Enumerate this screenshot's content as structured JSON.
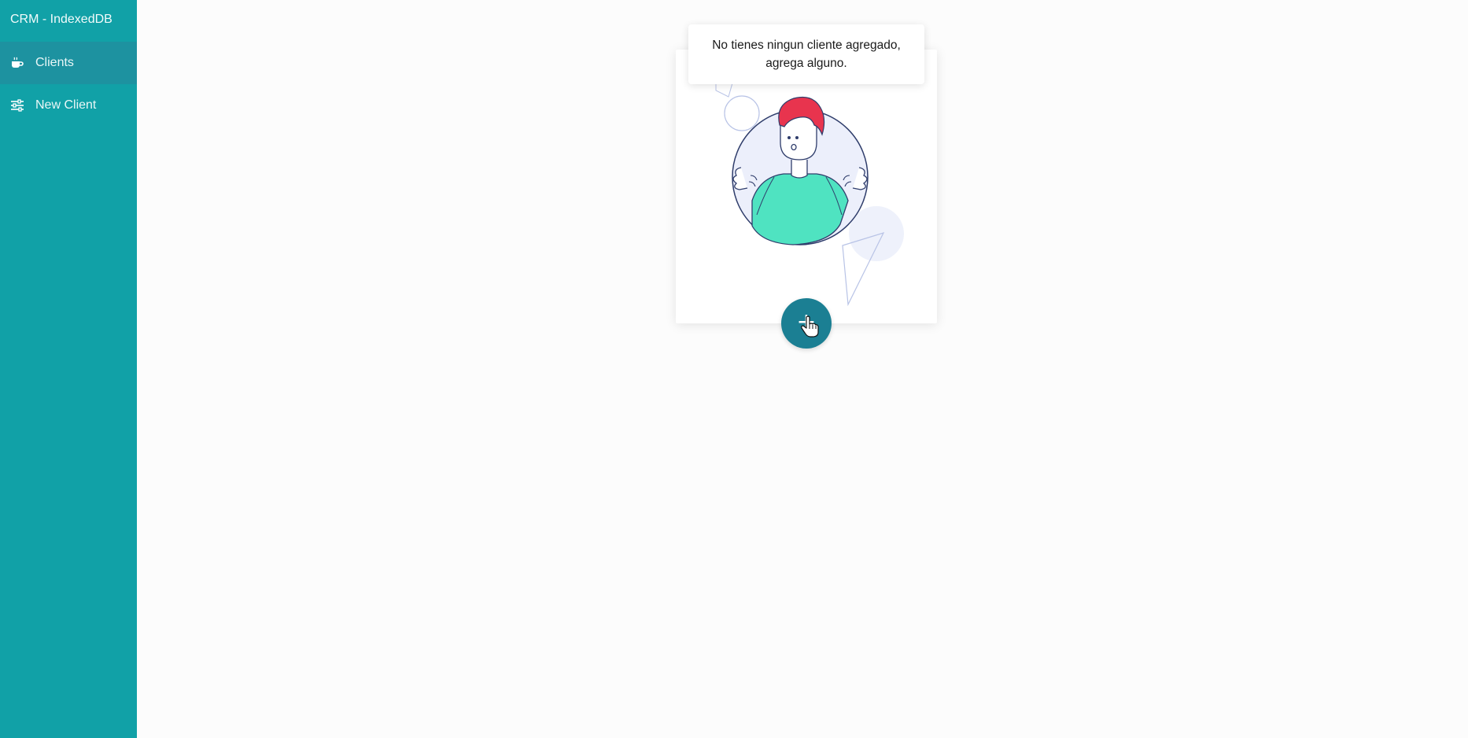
{
  "app": {
    "title": "CRM - IndexedDB"
  },
  "sidebar": {
    "items": [
      {
        "label": "Clients",
        "icon": "coffee-icon",
        "active": true
      },
      {
        "label": "New Client",
        "icon": "sliders-icon",
        "active": false
      }
    ]
  },
  "main": {
    "empty_state": {
      "message": "No tienes ningun cliente agregado, agrega alguno.",
      "add_button_label": "+"
    }
  },
  "colors": {
    "sidebar_bg": "#11a1a7",
    "active_item_bg": "#1d92a0",
    "fab_bg": "#1b7f93",
    "page_bg": "#fcfcfc",
    "shirt": "#4fe3c1",
    "hair": "#e8344e"
  }
}
